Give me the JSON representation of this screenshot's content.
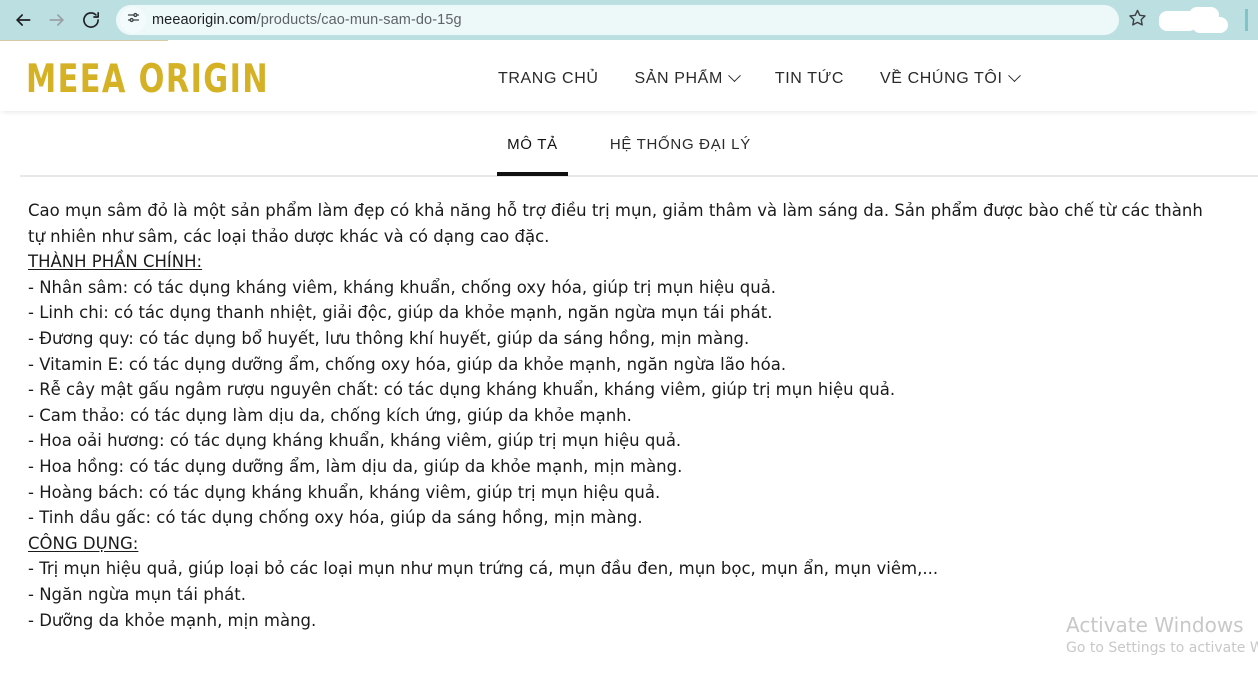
{
  "browser": {
    "back_icon": "back-arrow-icon",
    "forward_icon": "forward-arrow-icon",
    "reload_icon": "reload-icon",
    "site_info_icon": "site-settings-sliders-icon",
    "url_domain": "meeaorigin.com",
    "url_path": "/products/cao-mun-sam-do-15g",
    "url_full": "meeaorigin.com/products/cao-mun-sam-do-15g",
    "bookmark_icon": "star-icon",
    "chrome_bg": "#bcdfe2",
    "omnibox_bg": "#edf8f9"
  },
  "header": {
    "logo_text": "MEEA ORIGIN",
    "logo_color": "#d4b125",
    "nav": [
      {
        "label": "TRANG CHỦ",
        "has_caret": false
      },
      {
        "label": "SẢN PHẨM",
        "has_caret": true
      },
      {
        "label": "TIN TỨC",
        "has_caret": false
      },
      {
        "label": "VỀ CHÚNG TÔI",
        "has_caret": true
      }
    ]
  },
  "tabs": {
    "items": [
      {
        "label": "MÔ TẢ",
        "active": true
      },
      {
        "label": "HỆ THỐNG ĐẠI LÝ",
        "active": false
      }
    ]
  },
  "description": {
    "intro_line1": "Cao mụn sâm đỏ là một sản phẩm làm đẹp có khả năng hỗ trợ điều trị mụn, giảm thâm và làm sáng da. Sản phẩm được bào chế từ các thành",
    "intro_line2": "tự nhiên như sâm, các loại thảo dược khác và có dạng cao đặc.",
    "ingredients_title": "THÀNH PHẦN CHÍNH:",
    "ingredients": [
      "- Nhân sâm: có tác dụng kháng viêm, kháng khuẩn, chống oxy hóa, giúp trị mụn hiệu quả.",
      "- Linh chi: có tác dụng thanh nhiệt, giải độc, giúp da khỏe mạnh, ngăn ngừa mụn tái phát.",
      "- Đương quy: có tác dụng bổ huyết, lưu thông khí huyết, giúp da sáng hồng, mịn màng.",
      "- Vitamin E: có tác dụng dưỡng ẩm, chống oxy hóa, giúp da khỏe mạnh, ngăn ngừa lão hóa.",
      "- Rễ cây mật gấu ngâm rượu nguyên chất: có tác dụng kháng khuẩn, kháng viêm, giúp trị mụn hiệu quả.",
      "- Cam thảo: có tác dụng làm dịu da, chống kích ứng, giúp da khỏe mạnh.",
      "- Hoa oải hương: có tác dụng kháng khuẩn, kháng viêm, giúp trị mụn hiệu quả.",
      "- Hoa hồng: có tác dụng dưỡng ẩm, làm dịu da, giúp da khỏe mạnh, mịn màng.",
      "- Hoàng bách: có tác dụng kháng khuẩn, kháng viêm, giúp trị mụn hiệu quả.",
      "- Tinh dầu gấc: có tác dụng chống oxy hóa, giúp da sáng hồng, mịn màng."
    ],
    "uses_title": "CÔNG DỤNG:",
    "uses": [
      "- Trị mụn hiệu quả, giúp loại bỏ các loại mụn như mụn trứng cá, mụn đầu đen, mụn bọc, mụn ẩn, mụn viêm,...",
      "- Ngăn ngừa mụn tái phát.",
      "- Dưỡng da khỏe mạnh, mịn màng."
    ]
  },
  "watermark": {
    "title": "Activate Windows",
    "subtitle": "Go to Settings to activate Wi"
  }
}
